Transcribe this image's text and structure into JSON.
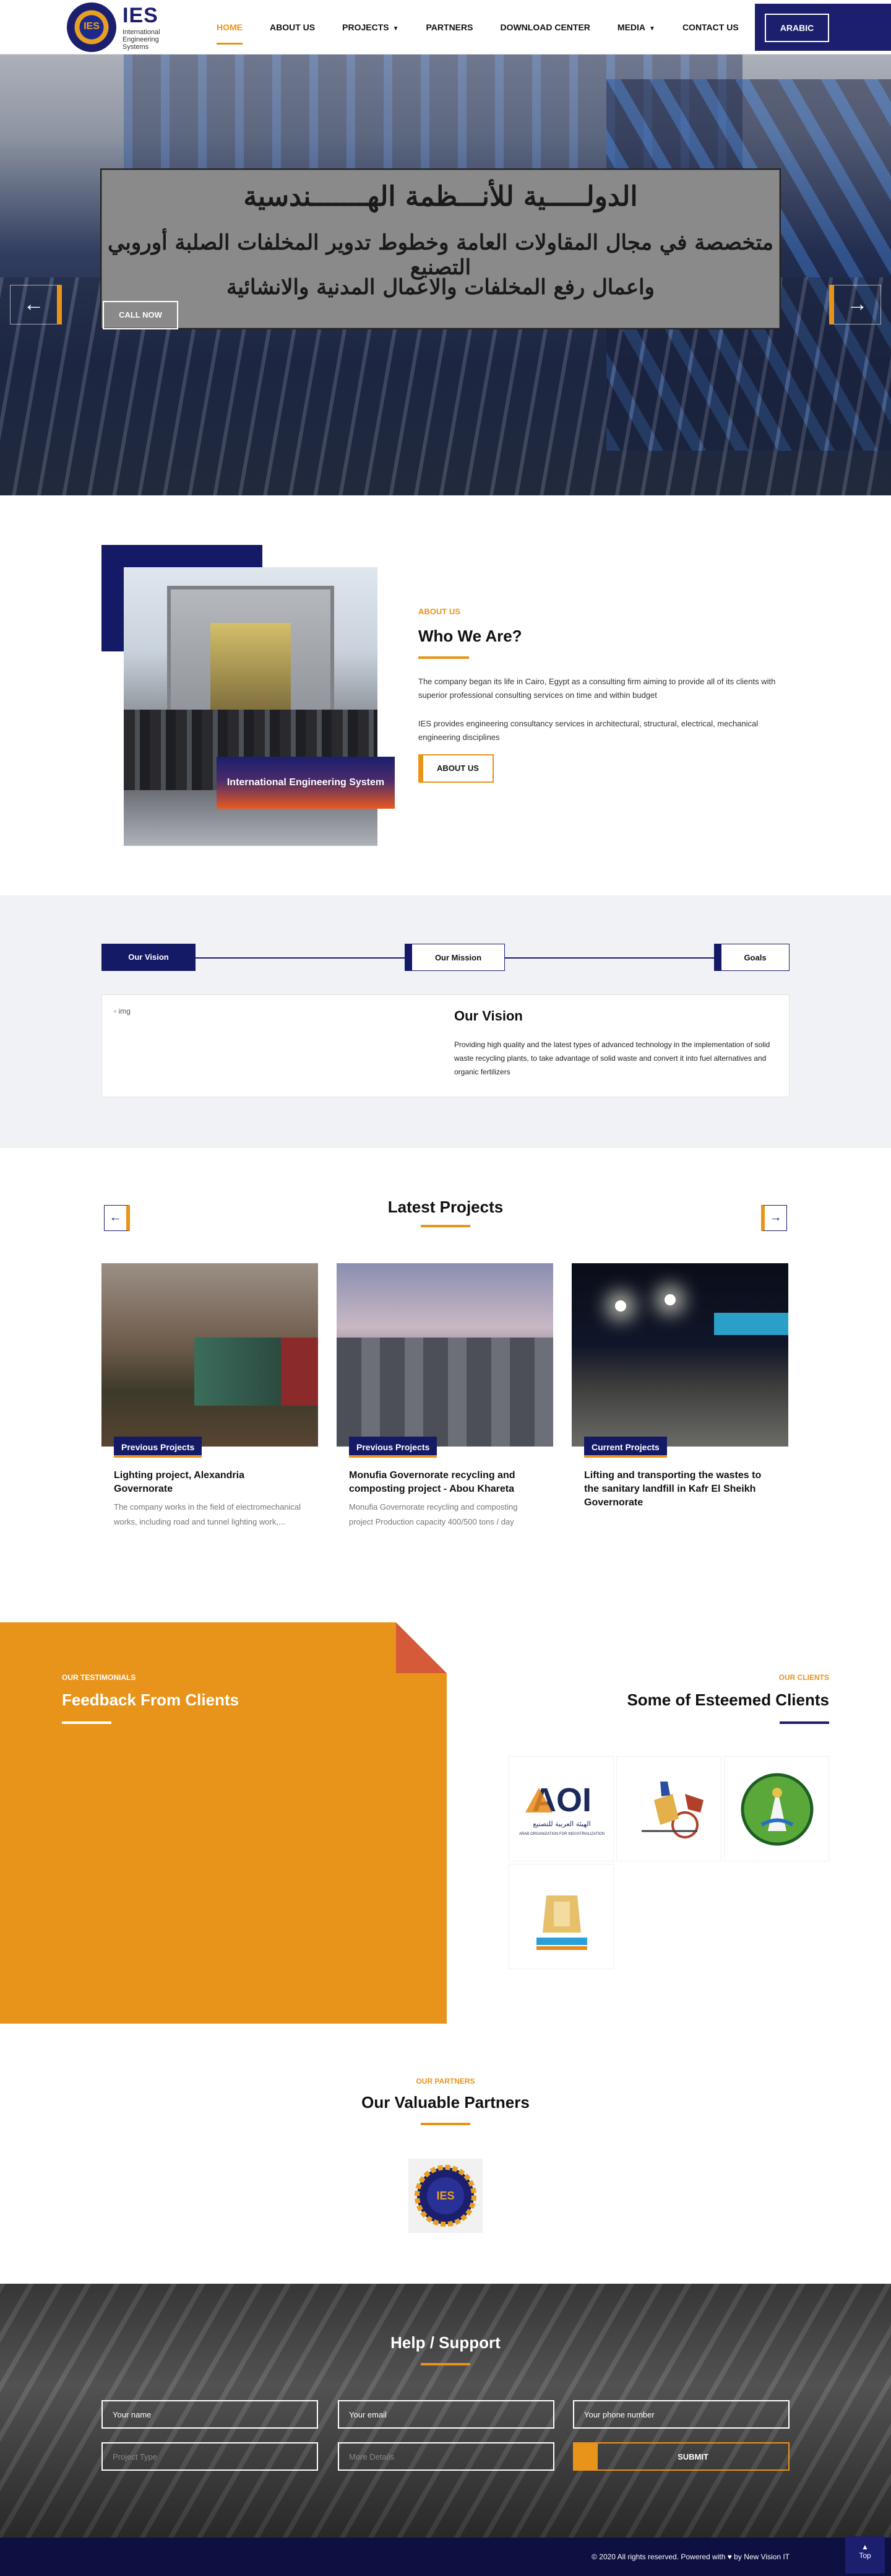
{
  "header": {
    "logo_text": "IES",
    "logo_badge": "IES",
    "logo_sub": "International Engineering Systems",
    "nav": [
      {
        "label": "HOME"
      },
      {
        "label": "ABOUT US"
      },
      {
        "label": "PROJECTS"
      },
      {
        "label": "PARTNERS"
      },
      {
        "label": "DOWNLOAD CENTER"
      },
      {
        "label": "MEDIA"
      },
      {
        "label": "CONTACT US"
      }
    ],
    "lang_button": "ARABIC",
    "accent": "#e8941a",
    "navy": "#1b1f6e"
  },
  "hero": {
    "line1": "الدولـــــية للأنـــظمة الهـــــــندسية",
    "line2": "متخصصة في مجال المقاولات العامة وخطوط تدوير المخلفات الصلبة أوروبي التصنيع",
    "line3": "واعمال رفع المخلفات والاعمال المدنية والانشائية",
    "cta": "CALL NOW",
    "prev_icon": "arrow-left-icon",
    "next_icon": "arrow-right-icon"
  },
  "about": {
    "kicker": "ABOUT US",
    "title": "Who We Are?",
    "photo_caption": "International Engineering System",
    "p1": "The company began its life in Cairo, Egypt as a consulting firm aiming to provide all of its clients with superior professional consulting services on time and within budget",
    "p2": "IES provides engineering consultancy services in architectural, structural, electrical, mechanical engineering disciplines",
    "button": "ABOUT US"
  },
  "vision": {
    "tabs": [
      {
        "label": "Our Vision"
      },
      {
        "label": "Our Mission"
      },
      {
        "label": "Goals"
      }
    ],
    "img_alt": "img",
    "title": "Our Vision",
    "text": "Providing high quality and the latest types of advanced technology in the implementation of solid waste recycling plants, to take advantage of solid waste and convert it into fuel alternatives and organic fertilizers"
  },
  "projects": {
    "title": "Latest Projects",
    "items": [
      {
        "badge": "Previous Projects",
        "title": "Lighting project, Alexandria Governorate",
        "desc": "The company works in the field of electromechanical works, including road and tunnel lighting work,..."
      },
      {
        "badge": "Previous Projects",
        "title": "Monufia Governorate recycling and composting project - Abou Khareta",
        "desc": "Monufia Governorate recycling and composting project Production capacity 400/500 tons / day"
      },
      {
        "badge": "Current Projects",
        "title": "Lifting and transporting the wastes to the sanitary landfill in Kafr El Sheikh Governorate",
        "desc": ""
      }
    ]
  },
  "testimonials": {
    "kicker": "OUR TESTIMONIALS",
    "title": "Feedback From Clients"
  },
  "clients": {
    "kicker": "OUR CLIENTS",
    "title": "Some of Esteemed Clients",
    "logos": [
      {
        "name": "AOI",
        "sub": "الهيئة العربية للتصنيع",
        "sub2": "ARAB ORGANIZATION FOR INDUSTRIALIZATION"
      }
    ]
  },
  "partners": {
    "kicker": "OUR PARTNERS",
    "title": "Our Valuable Partners",
    "logo_badge": "IES"
  },
  "support": {
    "title": "Help / Support",
    "fields": {
      "name": "Your name",
      "email": "Your email",
      "phone": "Your phone number",
      "type": "Project Type",
      "details": "More Details"
    },
    "submit": "SUBMIT"
  },
  "footer": {
    "text": "© 2020 All rights reserved. Powered with ♥ by New Vision IT",
    "top_label": "Top"
  }
}
